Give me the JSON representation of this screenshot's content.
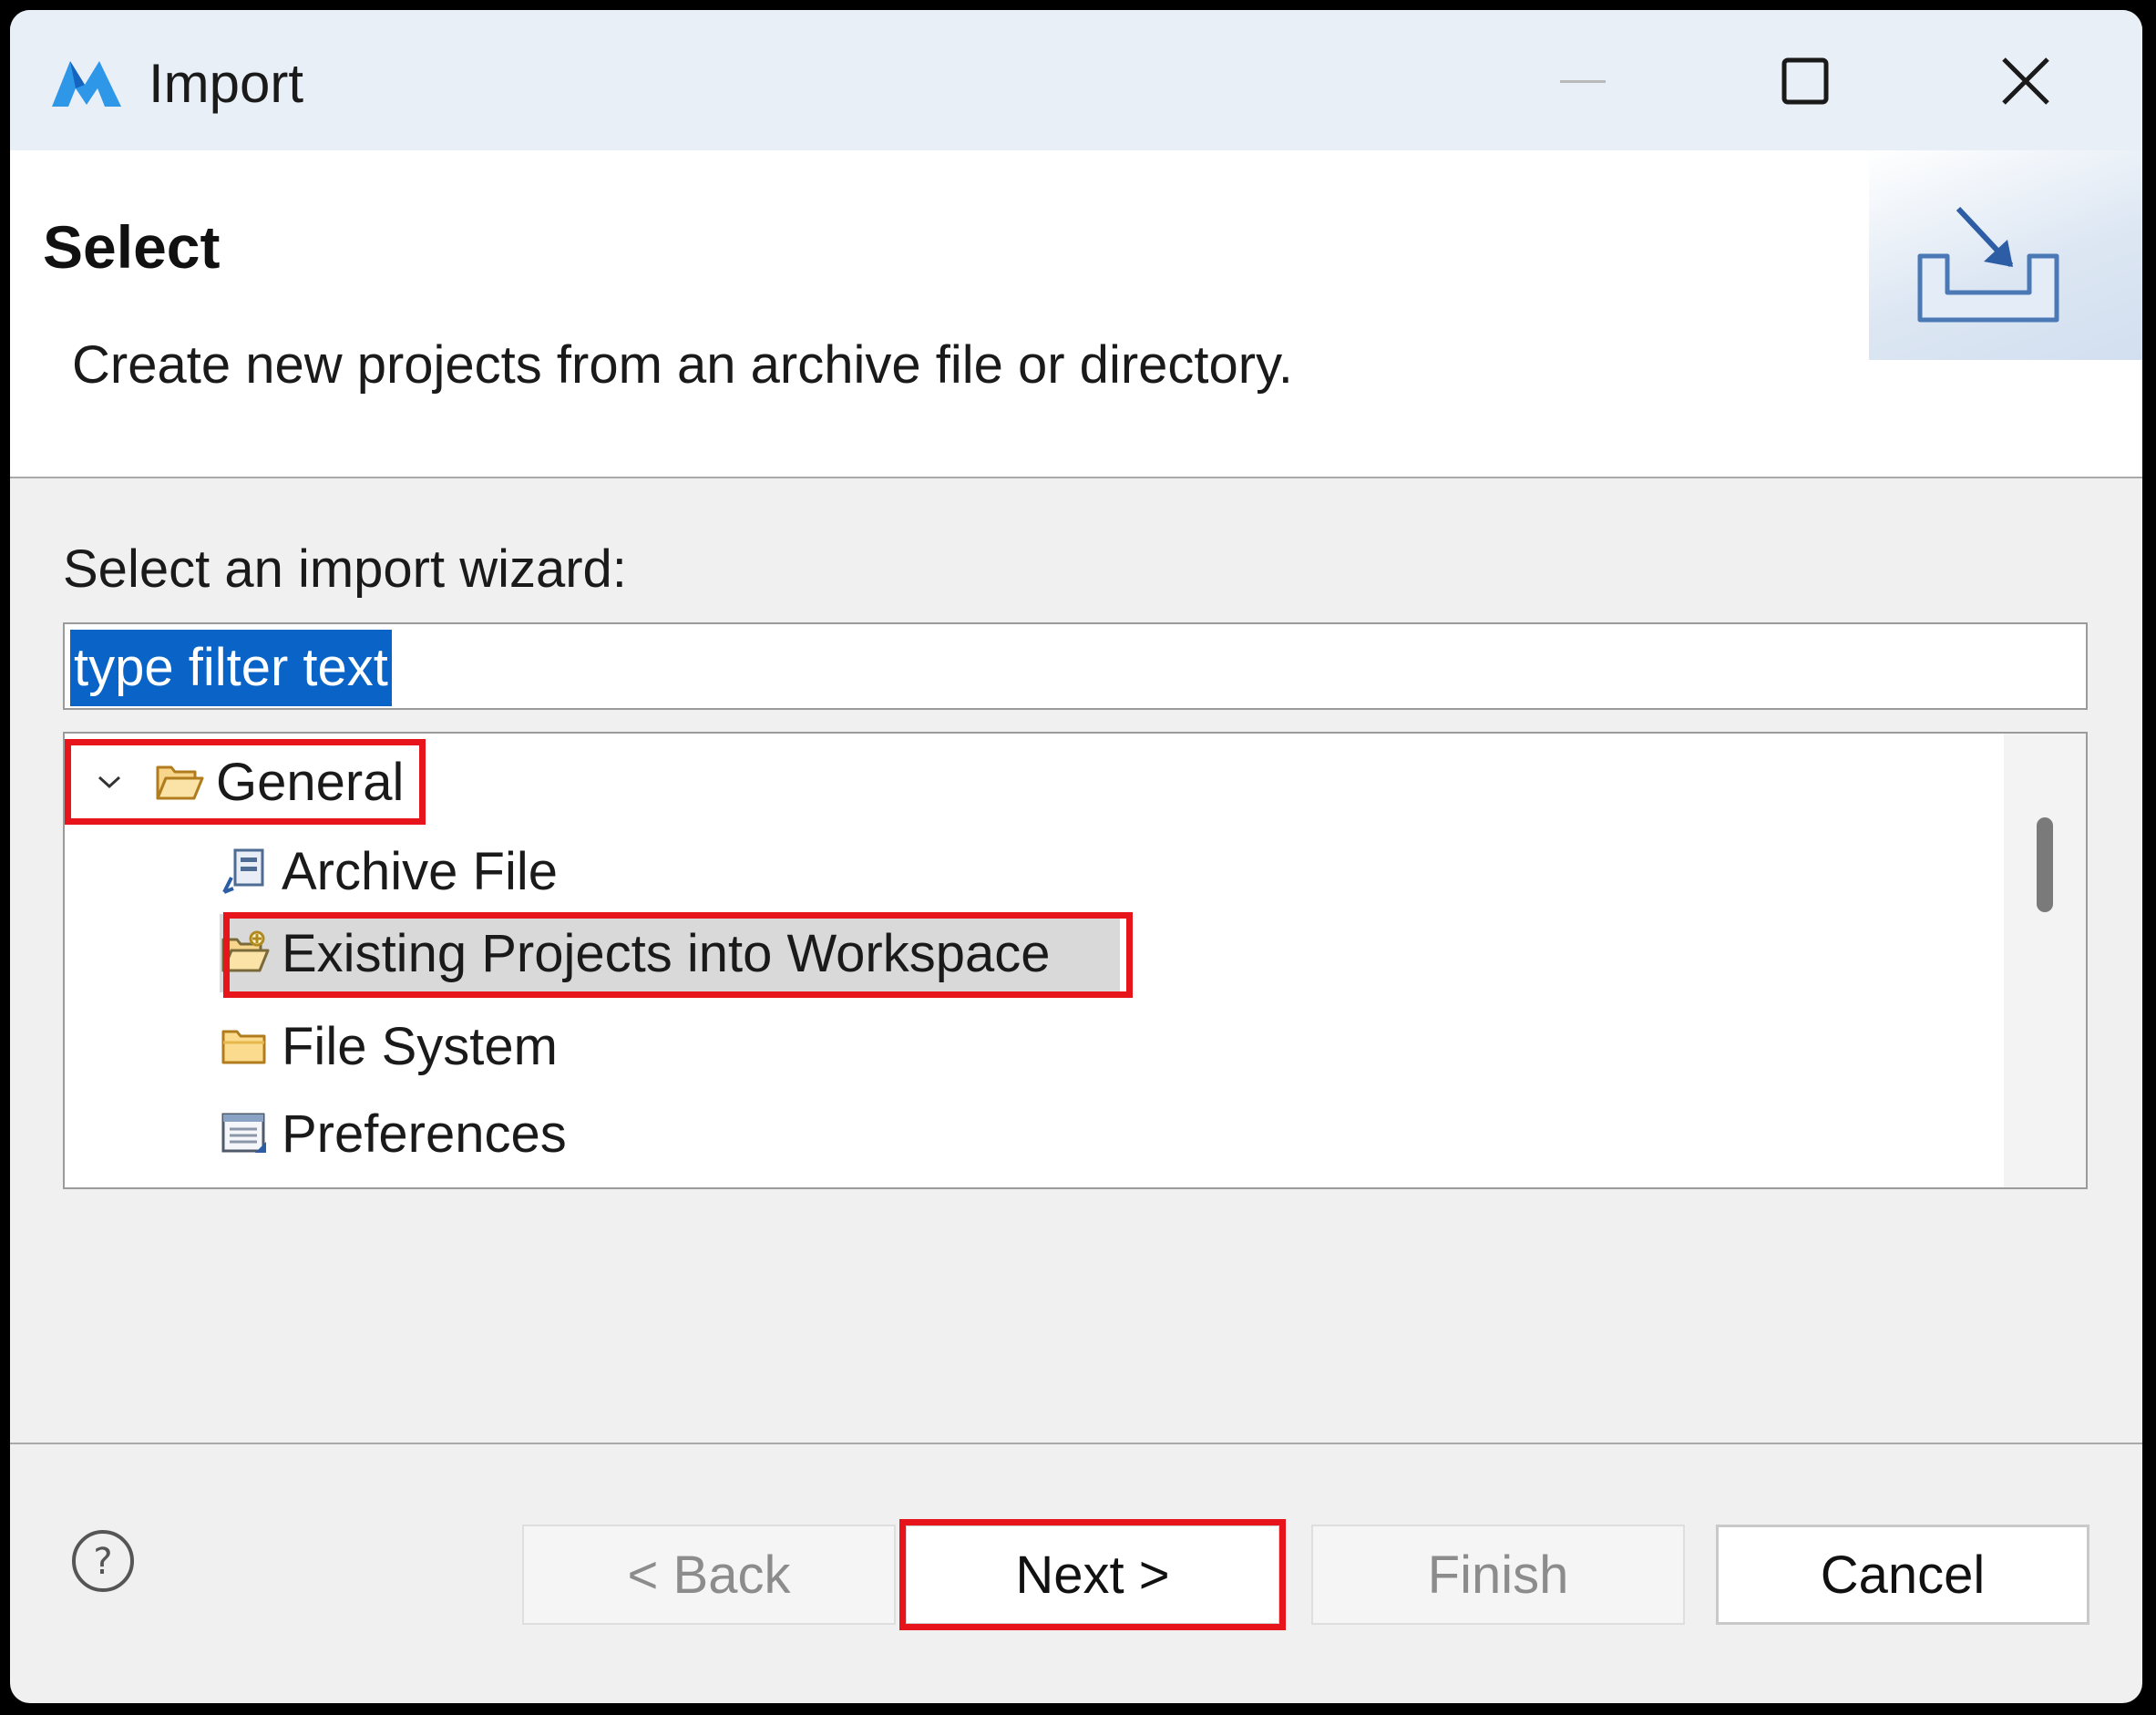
{
  "window": {
    "title": "Import"
  },
  "header": {
    "title": "Select",
    "description": "Create new projects from an archive file or directory."
  },
  "wizard": {
    "prompt": "Select an import wizard:",
    "filter_placeholder": "type filter text",
    "filter_value": "type filter text",
    "tree": {
      "category": {
        "label": "General",
        "icon": "folder-open-icon",
        "expanded": true
      },
      "items": [
        {
          "label": "Archive File",
          "icon": "archive-file-icon"
        },
        {
          "label": "Existing Projects into Workspace",
          "icon": "project-folder-icon",
          "selected": true
        },
        {
          "label": "File System",
          "icon": "folder-icon"
        },
        {
          "label": "Preferences",
          "icon": "preferences-icon"
        }
      ]
    }
  },
  "buttons": {
    "back": "< Back",
    "next": "Next >",
    "finish": "Finish",
    "cancel": "Cancel"
  },
  "colors": {
    "highlight": "#e8141c",
    "selection": "#0a64c8",
    "title_bar": "#e9eff6"
  }
}
